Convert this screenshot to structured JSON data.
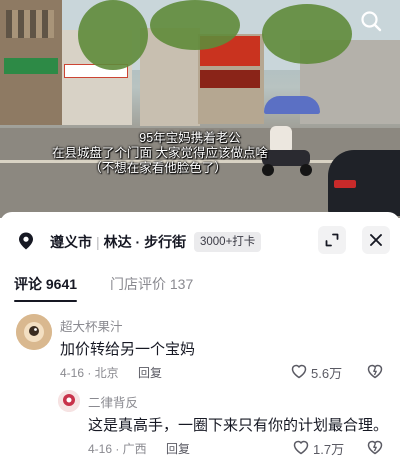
{
  "video": {
    "caption_lines": [
      "95年宝妈携着老公",
      "在县城盘了个门面 大家觉得应该做点啥",
      "（不想在家看他脸色了）"
    ],
    "search_icon": "search-icon"
  },
  "location": {
    "city": "遵义市",
    "place": "林达 · 步行街",
    "badge": "3000+打卡",
    "expand_icon": "expand-icon",
    "close_icon": "close-icon"
  },
  "tabs": [
    {
      "label": "评论 9641",
      "active": true
    },
    {
      "label": "门店评价 137",
      "active": false
    }
  ],
  "comments": [
    {
      "user": "超大杯果汁",
      "text": "加价转给另一个宝妈",
      "date_location": "4-16 · 北京",
      "reply_label": "回复",
      "likes": "5.6万"
    },
    {
      "user": "二律背反",
      "text": "这是真高手，一圈下来只有你的计划最合理。",
      "date_location": "4-16 · 广西",
      "reply_label": "回复",
      "likes": "1.7万"
    }
  ],
  "colors": {
    "text_primary": "#161823",
    "text_secondary": "#8a8a90",
    "badge_bg": "#ebebed"
  }
}
